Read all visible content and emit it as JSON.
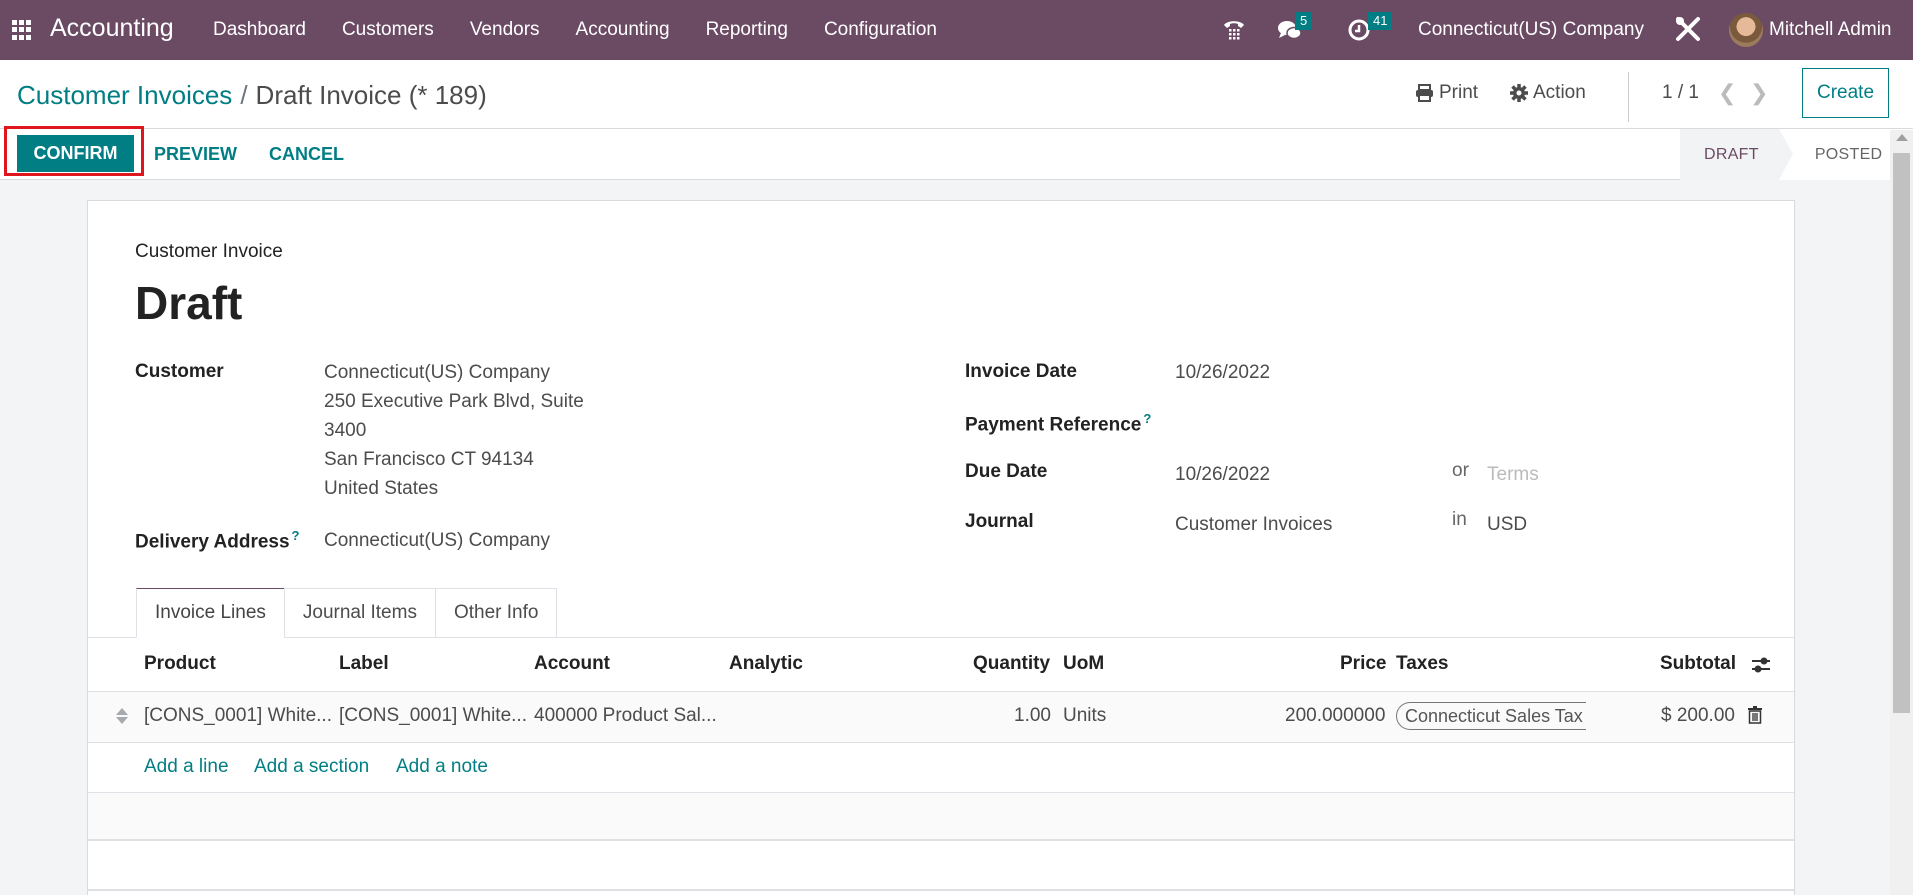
{
  "navbar": {
    "app_name": "Accounting",
    "menu": [
      "Dashboard",
      "Customers",
      "Vendors",
      "Accounting",
      "Reporting",
      "Configuration"
    ],
    "messages_count": "5",
    "activities_count": "41",
    "company": "Connecticut(US) Company",
    "user": "Mitchell Admin",
    "colors": {
      "navbar": "#6b4a64",
      "accent": "#017e84"
    }
  },
  "breadcrumb": {
    "parent": "Customer Invoices",
    "separator": "/",
    "current": "Draft Invoice (* 189)"
  },
  "control_panel": {
    "print_label": "Print",
    "action_label": "Action",
    "pager": "1 / 1",
    "create_label": "Create"
  },
  "buttons": {
    "confirm": "CONFIRM",
    "preview": "PREVIEW",
    "cancel": "CANCEL"
  },
  "statusbar": {
    "stages": [
      "DRAFT",
      "POSTED"
    ],
    "current": "DRAFT"
  },
  "form": {
    "doc_type": "Customer Invoice",
    "title": "Draft",
    "customer_label": "Customer",
    "customer_name": "Connecticut(US) Company",
    "customer_address": [
      "250 Executive Park Blvd, Suite",
      "3400",
      "San Francisco CT 94134",
      "United States"
    ],
    "delivery_label": "Delivery Address",
    "delivery_value": "Connecticut(US) Company",
    "invoice_date_label": "Invoice Date",
    "invoice_date": "10/26/2022",
    "payment_ref_label": "Payment Reference",
    "payment_ref": "",
    "due_date_label": "Due Date",
    "due_date": "10/26/2022",
    "or_label": "or",
    "terms_placeholder": "Terms",
    "journal_label": "Journal",
    "journal": "Customer Invoices",
    "in_label": "in",
    "currency": "USD",
    "help_mark": "?"
  },
  "tabs": [
    "Invoice Lines",
    "Journal Items",
    "Other Info"
  ],
  "lines": {
    "columns": [
      "Product",
      "Label",
      "Account",
      "Analytic",
      "Quantity",
      "UoM",
      "Price",
      "Taxes",
      "Subtotal"
    ],
    "rows": [
      {
        "product": "[CONS_0001] White...",
        "label": "[CONS_0001] White...",
        "account": "400000 Product Sal...",
        "analytic": "",
        "quantity": "1.00",
        "uom": "Units",
        "price": "200.000000",
        "taxes": "Connecticut Sales Tax (",
        "subtotal": "$ 200.00"
      }
    ],
    "add_line": "Add a line",
    "add_section": "Add a section",
    "add_note": "Add a note"
  }
}
